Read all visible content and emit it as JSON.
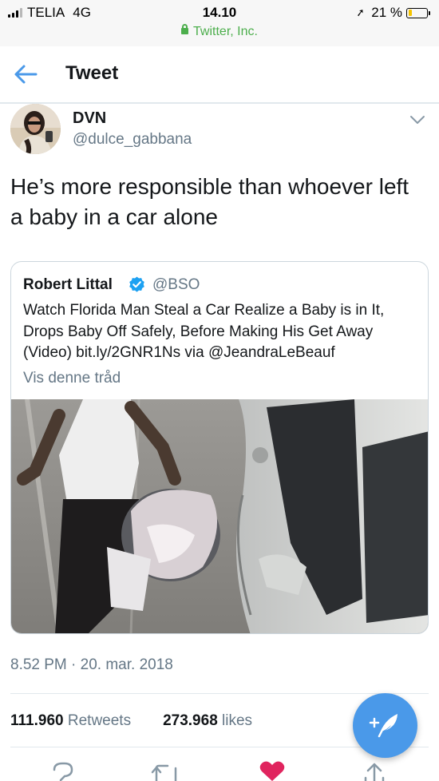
{
  "status_bar": {
    "carrier": "TELIA",
    "network": "4G",
    "time": "14.10",
    "url": "Twitter, Inc.",
    "battery": "21 %",
    "battery_level": 0.21
  },
  "header": {
    "title": "Tweet",
    "back_icon": "back-arrow-icon"
  },
  "tweet": {
    "author_name": "DVN",
    "author_handle": "@dulce_gabbana",
    "text": "He’s more responsible than whoever left a baby in a car alone",
    "timestamp": "8.52 PM · 20. mar. 2018",
    "retweets_count": "111.960",
    "retweets_label": "Retweets",
    "likes_count": "273.968",
    "likes_label": "likes"
  },
  "quoted_tweet": {
    "author_name": "Robert Littal",
    "author_handle": "@BSO",
    "text": "Watch Florida Man Steal a Car Realize a Baby is in It, Drops Baby Off Safely, Before Making His Get Away (Video) bit.ly/2GNR1Ns via @JeandraLeBeauf",
    "thread_link": "Vis denne tråd"
  },
  "colors": {
    "accent": "#4a99e9",
    "secure_green": "#4cae4c",
    "like_red": "#e0245e",
    "muted": "#657786"
  },
  "icons": [
    "back-arrow-icon",
    "chevron-down-icon",
    "verified-badge-icon",
    "reply-icon",
    "retweet-icon",
    "like-icon",
    "share-icon",
    "compose-tweet-icon"
  ]
}
